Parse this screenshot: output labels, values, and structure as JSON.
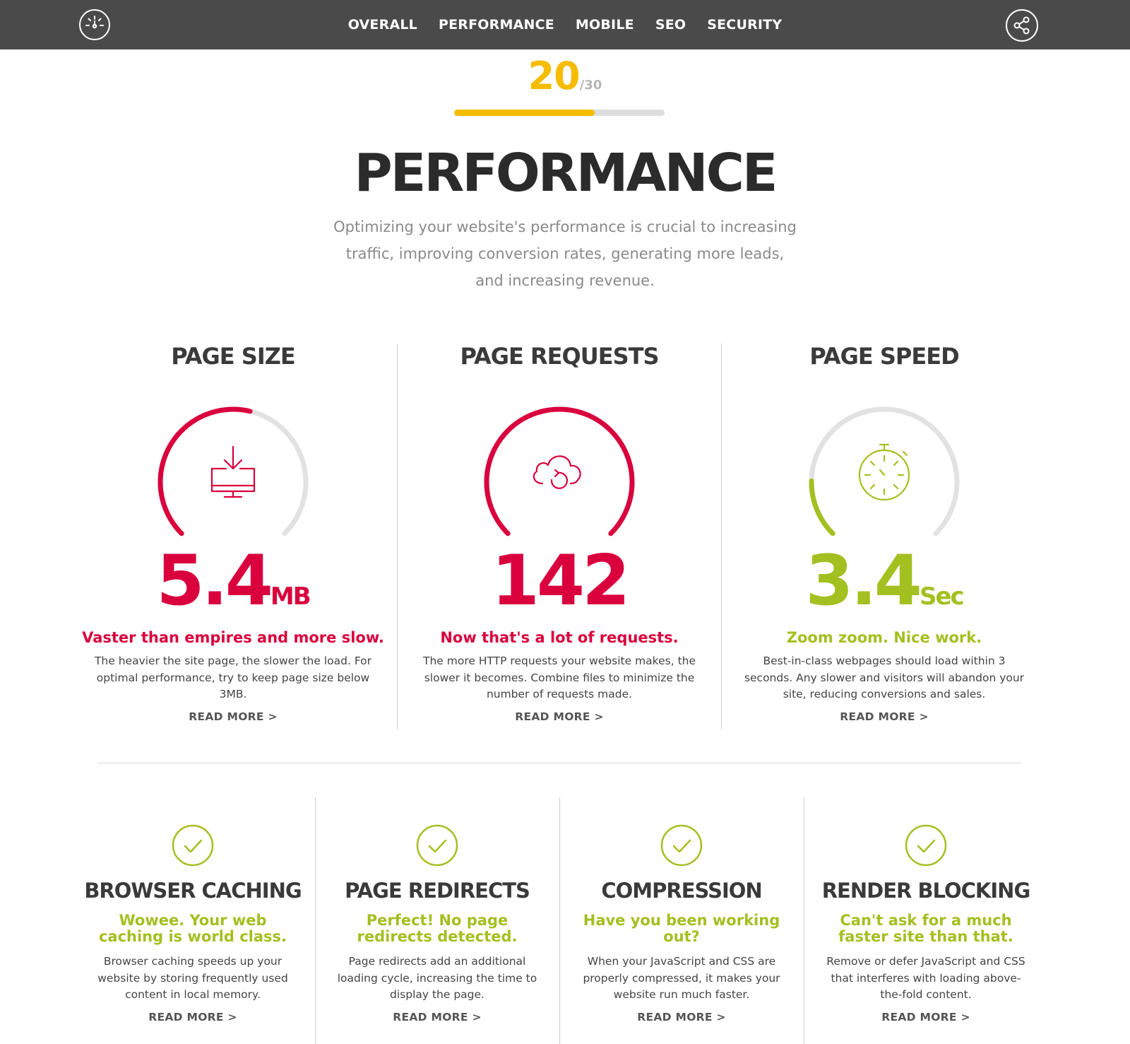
{
  "nav": {
    "items": [
      "OVERALL",
      "PERFORMANCE",
      "MOBILE",
      "SEO",
      "SECURITY"
    ],
    "logo_icon": "speedometer-icon",
    "share_icon": "share-icon"
  },
  "score": {
    "value": "20",
    "max": "/30",
    "fraction": 0.6667,
    "color": "#f5bc00"
  },
  "page": {
    "title": "PERFORMANCE",
    "intro": "Optimizing your website's performance is crucial to increasing traffic, improving conversion rates, generating more leads, and increasing revenue."
  },
  "colors": {
    "bad": "#d9003d",
    "good": "#a3c021",
    "track": "#e2e2e2"
  },
  "metrics": [
    {
      "title": "PAGE SIZE",
      "value": "5.4",
      "unit": "MB",
      "gauge_fraction": 0.55,
      "status": "bad",
      "icon": "download-monitor-icon",
      "tagline": "Vaster than empires and more slow.",
      "description": "The heavier the site page, the slower the load. For optimal performance, try to keep page size below 3MB.",
      "link": "READ MORE >"
    },
    {
      "title": "PAGE REQUESTS",
      "value": "142",
      "unit": "",
      "gauge_fraction": 1.0,
      "status": "bad",
      "icon": "cloud-refresh-icon",
      "tagline": "Now that's a lot of requests.",
      "description": "The more HTTP requests your website makes, the slower it becomes. Combine files to minimize the number of requests made.",
      "link": "READ MORE >"
    },
    {
      "title": "PAGE SPEED",
      "value": "3.4",
      "unit": "Sec",
      "gauge_fraction": 0.17,
      "status": "good",
      "icon": "stopwatch-icon",
      "tagline": "Zoom zoom. Nice work.",
      "description": "Best-in-class webpages should load within 3 seconds. Any slower and visitors will abandon your site, reducing conversions and sales.",
      "link": "READ MORE >"
    }
  ],
  "checks": [
    {
      "title": "BROWSER CACHING",
      "tagline": "Wowee. Your web caching is world class.",
      "description": "Browser caching speeds up your website by storing frequently used content in local memory.",
      "link": "READ MORE >"
    },
    {
      "title": "PAGE REDIRECTS",
      "tagline": "Perfect! No page redirects detected.",
      "description": "Page redirects add an additional loading cycle, increasing the time to display the page.",
      "link": "READ MORE >"
    },
    {
      "title": "COMPRESSION",
      "tagline": "Have you been working out?",
      "description": "When your JavaScript and CSS are properly compressed, it makes your website run much faster.",
      "link": "READ MORE >"
    },
    {
      "title": "RENDER BLOCKING",
      "tagline": "Can't ask for a much faster site than that.",
      "description": "Remove or defer JavaScript and CSS that interferes with loading above-the-fold content.",
      "link": "READ MORE >"
    }
  ]
}
